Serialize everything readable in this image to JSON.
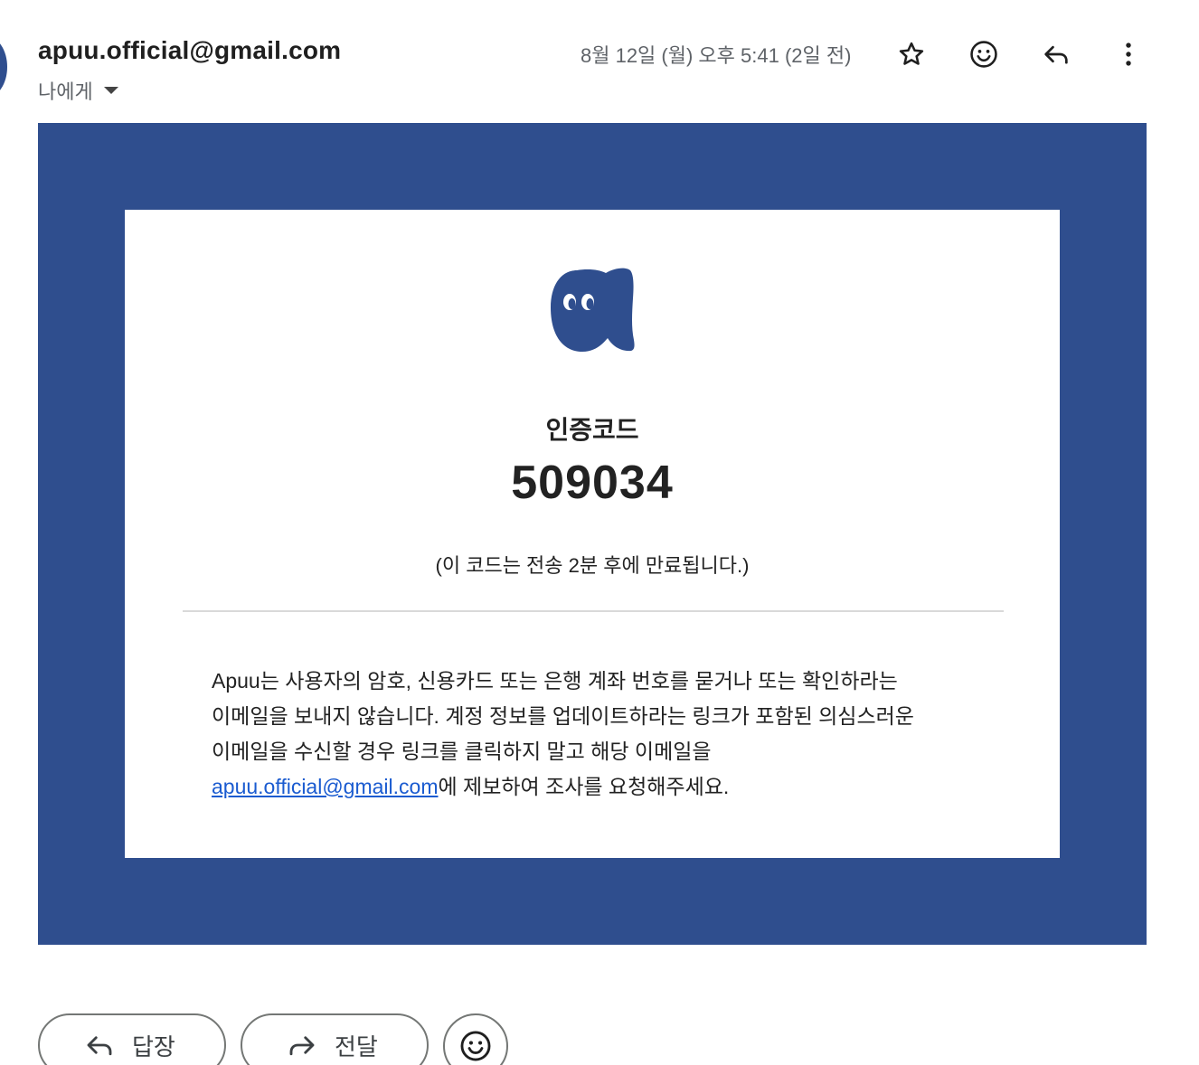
{
  "header": {
    "sender": "apuu.official@gmail.com",
    "recipient": "나에게",
    "date": "8월 12일 (월) 오후 5:41 (2일 전)",
    "icons": [
      "star-icon",
      "emoji-icon",
      "reply-icon",
      "more-vert-icon"
    ]
  },
  "email": {
    "code_label": "인증코드",
    "code": "509034",
    "expiry_note": "(이 코드는 전송 2분 후에 만료됩니다.)",
    "notice_line1": "Apuu는 사용자의 암호, 신용카드 또는 은행 계좌 번호를 묻거나 또는 확인하라는",
    "notice_line2": "이메일을 보내지 않습니다. 계정 정보를 업데이트하라는 링크가 포함된 의심스러운",
    "notice_line3": "이메일을 수신할 경우 링크를 클릭하지 말고 해당 이메일을",
    "notice_link": "apuu.official@gmail.com",
    "notice_tail": "에 제보하여 조사를 요청해주세요.",
    "frame_color": "#2f4e8e",
    "link_color": "#1a5bd0"
  },
  "actions": {
    "reply_label": "답장",
    "forward_label": "전달",
    "emoji_icon": "emoji-icon"
  }
}
